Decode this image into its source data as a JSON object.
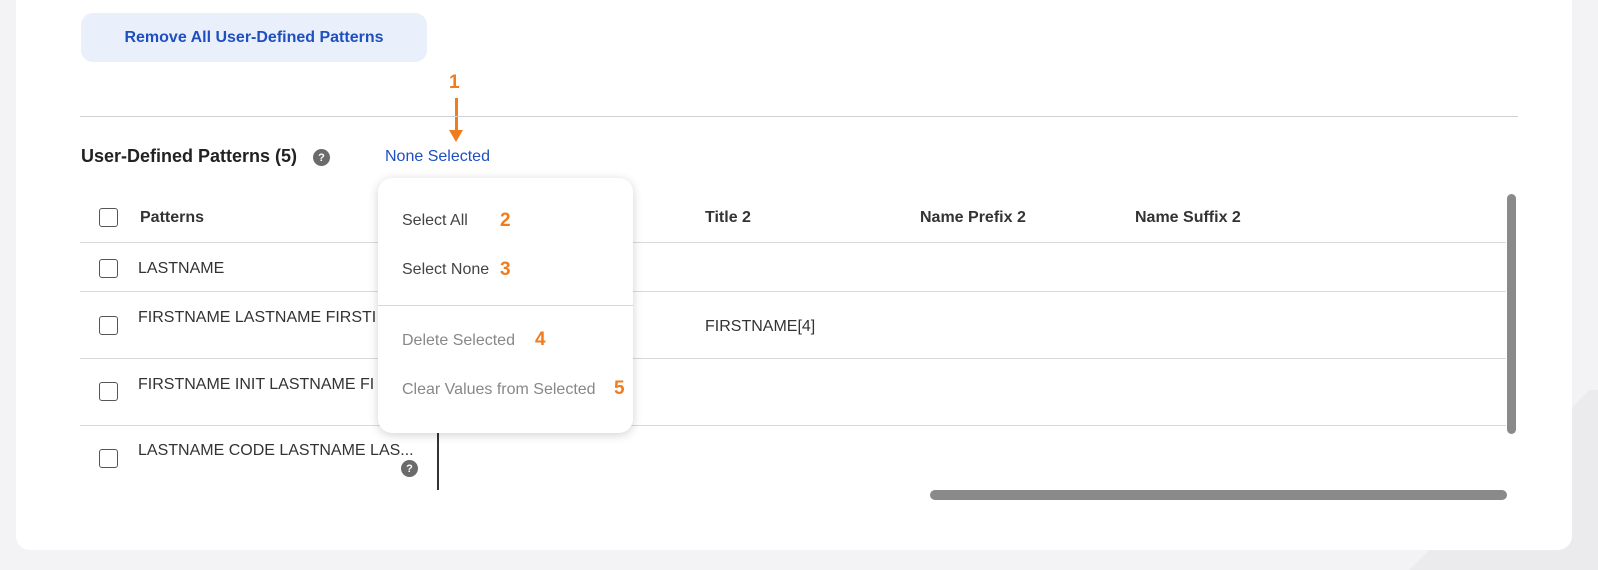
{
  "toolbar": {
    "remove_all_label": "Remove All User-Defined Patterns"
  },
  "section": {
    "title": "User-Defined Patterns (5)",
    "help_glyph": "?",
    "selection_status": "None Selected"
  },
  "annotations": [
    "1",
    "2",
    "3",
    "4",
    "5"
  ],
  "table": {
    "columns": [
      "Patterns",
      "Title 2",
      "Name Prefix 2",
      "Name Suffix 2"
    ],
    "rows": [
      {
        "pattern": "LASTNAME",
        "title2": ""
      },
      {
        "pattern": "FIRSTNAME LASTNAME FIRSTI",
        "title2": "FIRSTNAME[4]"
      },
      {
        "pattern": "FIRSTNAME INIT LASTNAME FI",
        "title2": ""
      },
      {
        "pattern": "LASTNAME CODE LASTNAME LAS...",
        "title2": ""
      }
    ]
  },
  "menu": {
    "items": [
      {
        "label": "Select All",
        "enabled": true
      },
      {
        "label": "Select None",
        "enabled": true
      },
      {
        "label": "Delete Selected",
        "enabled": false
      },
      {
        "label": "Clear Values from Selected",
        "enabled": false
      }
    ]
  },
  "colors": {
    "accent": "#1f4fbf",
    "annotation": "#f07c1e",
    "button_bg": "#e9f0fb"
  }
}
